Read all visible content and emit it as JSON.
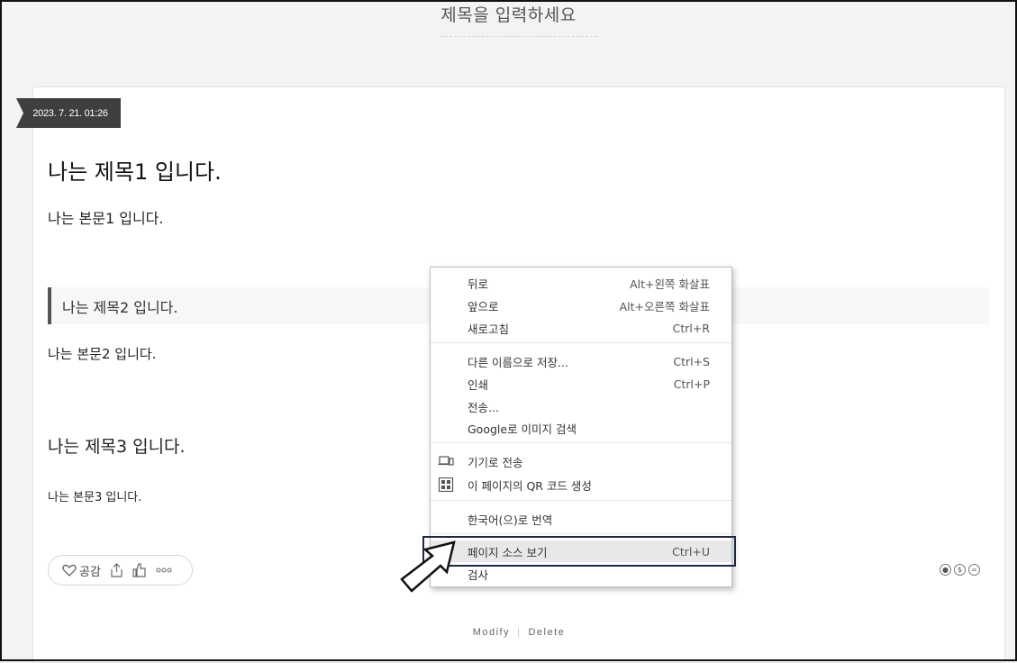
{
  "blog": {
    "title": "제목을 입력하세요"
  },
  "post": {
    "date": "2023. 7. 21. 01:26",
    "title1": "나는 제목1 입니다.",
    "body1": "나는 본문1 입니다.",
    "title2": "나는 제목2 입니다.",
    "body2": "나는 본문2 입니다.",
    "title3": "나는 제목3 입니다.",
    "body3": "나는 본문3 입니다."
  },
  "actions": {
    "like_label": "공감",
    "like_icon": "heart-outline-icon",
    "share_icon": "share-icon",
    "thumb_icon": "thumbs-up-icon",
    "more_icon": "more-dots-icon"
  },
  "license_icons": [
    "cc-by-icon",
    "cc-nc-icon",
    "cc-nd-icon"
  ],
  "footer": {
    "modify": "Modify",
    "separator": "|",
    "delete": "Delete"
  },
  "context_menu": {
    "back": {
      "label": "뒤로",
      "shortcut": "Alt+왼쪽 화살표"
    },
    "forward": {
      "label": "앞으로",
      "shortcut": "Alt+오른쪽 화살표"
    },
    "reload": {
      "label": "새로고침",
      "shortcut": "Ctrl+R"
    },
    "save_as": {
      "label": "다른 이름으로 저장...",
      "shortcut": "Ctrl+S"
    },
    "print": {
      "label": "인쇄",
      "shortcut": "Ctrl+P"
    },
    "cast": {
      "label": "전송..."
    },
    "google_image": {
      "label": "Google로 이미지 검색"
    },
    "send_device": {
      "label": "기기로 전송",
      "icon": "device-send-icon"
    },
    "qr_code": {
      "label": "이 페이지의 QR 코드 생성",
      "icon": "qr-code-icon"
    },
    "translate": {
      "label": "한국어(으)로 번역"
    },
    "view_source": {
      "label": "페이지 소스 보기",
      "shortcut": "Ctrl+U"
    },
    "inspect": {
      "label": "검사"
    }
  },
  "colors": {
    "highlight_border": "#1a2a45",
    "ribbon": "#3f3f3f",
    "quote_bar": "#555555"
  }
}
